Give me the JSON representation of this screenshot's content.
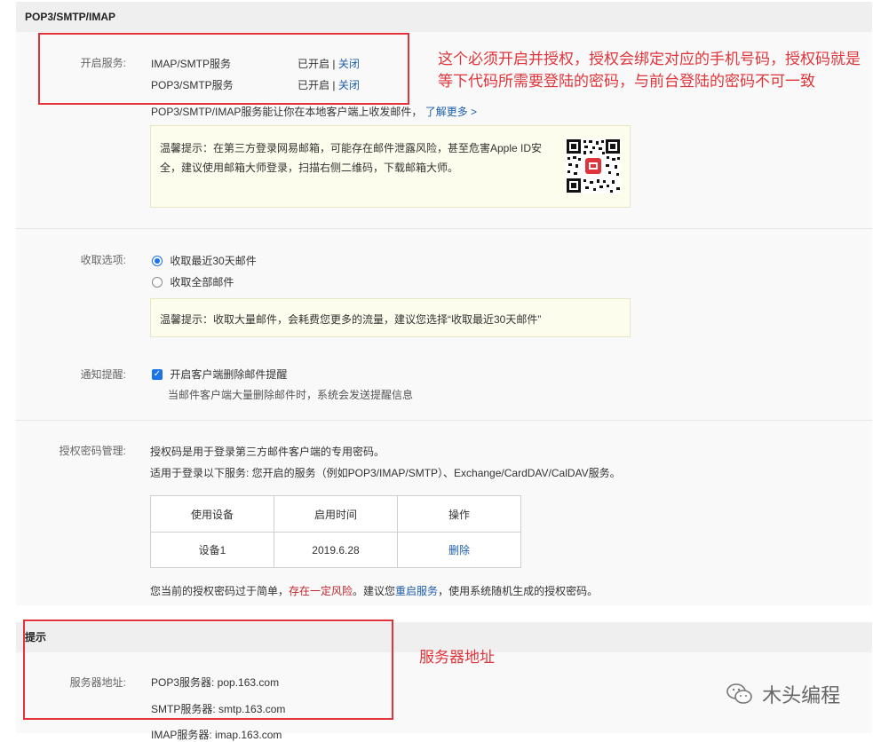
{
  "pop_section": {
    "title": "POP3/SMTP/IMAP",
    "service_label": "开启服务:",
    "services": [
      {
        "name": "IMAP/SMTP服务",
        "status": "已开启",
        "sep": "|",
        "action": "关闭"
      },
      {
        "name": "POP3/SMTP服务",
        "status": "已开启",
        "sep": "|",
        "action": "关闭"
      }
    ],
    "desc": "POP3/SMTP/IMAP服务能让你在本地客户端上收发邮件，",
    "learn_more": "了解更多 >",
    "warm_tip": "温馨提示：在第三方登录网易邮箱，可能存在邮件泄露风险，甚至危害Apple ID安全，建议使用邮箱大师登录，扫描右侧二维码，下载邮箱大师。"
  },
  "receive": {
    "label": "收取选项:",
    "options": [
      "收取最近30天邮件",
      "收取全部邮件"
    ],
    "selected": 0,
    "tip": "温馨提示：收取大量邮件，会耗费您更多的流量，建议您选择“收取最近30天邮件”"
  },
  "notify": {
    "label": "通知提醒:",
    "checkbox_label": "开启客户端删除邮件提醒",
    "checked": true,
    "desc": "当邮件客户端大量删除邮件时，系统会发送提醒信息"
  },
  "auth": {
    "label": "授权密码管理:",
    "line1": "授权码是用于登录第三方邮件客户端的专用密码。",
    "line2": "适用于登录以下服务: 您开启的服务（例如POP3/IMAP/SMTP）、Exchange/CardDAV/CalDAV服务。",
    "table_headers": [
      "使用设备",
      "启用时间",
      "操作"
    ],
    "rows": [
      {
        "device": "设备1",
        "date": "2019.6.28",
        "action": "删除"
      }
    ],
    "warn_pre": "您当前的授权密码过于简单，",
    "warn_risk": "存在一定风险",
    "warn_mid": "。建议您",
    "warn_link": "重启服务",
    "warn_post": "，使用系统随机生成的授权密码。"
  },
  "hint_section": {
    "title": "提示",
    "server_label": "服务器地址:",
    "servers": [
      "POP3服务器: pop.163.com",
      "SMTP服务器: smtp.163.com",
      "IMAP服务器: imap.163.com"
    ]
  },
  "annotations": {
    "top": "这个必须开启并授权，授权会绑定对应的手机号码，授权码就是等下代码所需要登陆的密码，与前台登陆的密码不可一致",
    "server": "服务器地址"
  },
  "watermark": "木头编程",
  "colors": {
    "link": "#1d5ea8",
    "annotation": "#e0343a",
    "accent": "#1a73e8"
  }
}
